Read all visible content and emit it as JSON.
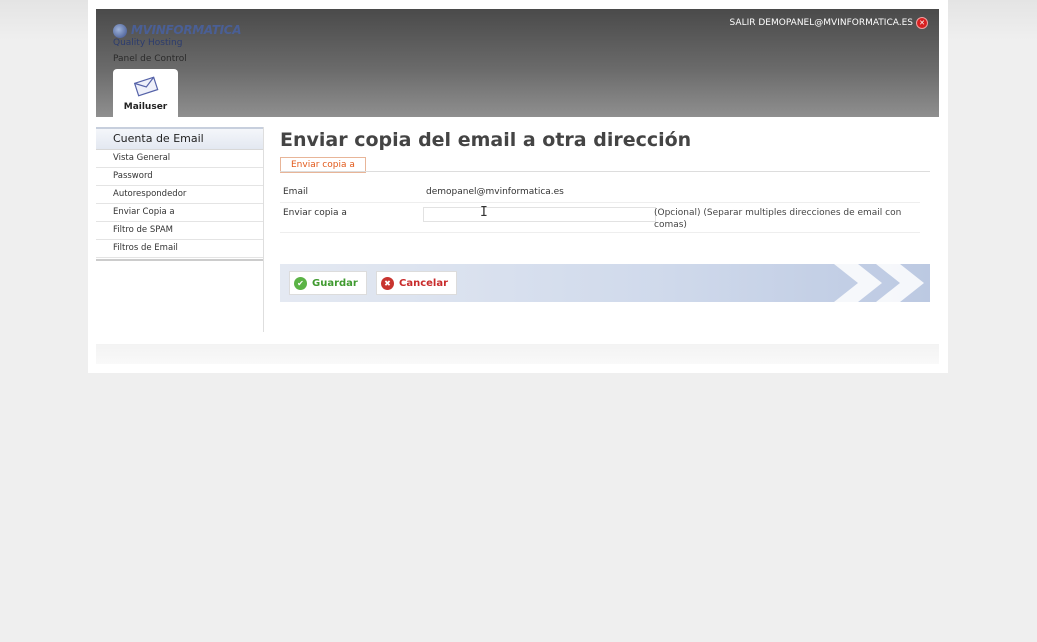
{
  "header": {
    "brand": "MVINFORMATICA",
    "tagline": "Quality Hosting",
    "panel_label": "Panel de Control",
    "logout_label": "SALIR DEMOPANEL@MVINFORMATICA.ES",
    "tab_label": "Mailuser"
  },
  "sidebar": {
    "section": "Cuenta de Email",
    "items": [
      {
        "label": "Vista General"
      },
      {
        "label": "Password"
      },
      {
        "label": "Autorespondedor"
      },
      {
        "label": "Enviar Copia a"
      },
      {
        "label": "Filtro de SPAM"
      },
      {
        "label": "Filtros de Email"
      }
    ]
  },
  "main": {
    "title": "Enviar copia del email a otra dirección",
    "subtab": "Enviar copia a",
    "fields": {
      "email_label": "Email",
      "email_value": "demopanel@mvinformatica.es",
      "forward_label": "Enviar copia a",
      "forward_value": "",
      "forward_hint": "(Opcional) (Separar multiples direcciones de email con comas)"
    },
    "buttons": {
      "save": "Guardar",
      "cancel": "Cancelar"
    }
  },
  "colors": {
    "accent_orange": "#e25a1b",
    "save_green": "#3f9a2f",
    "cancel_red": "#c82a2a"
  }
}
